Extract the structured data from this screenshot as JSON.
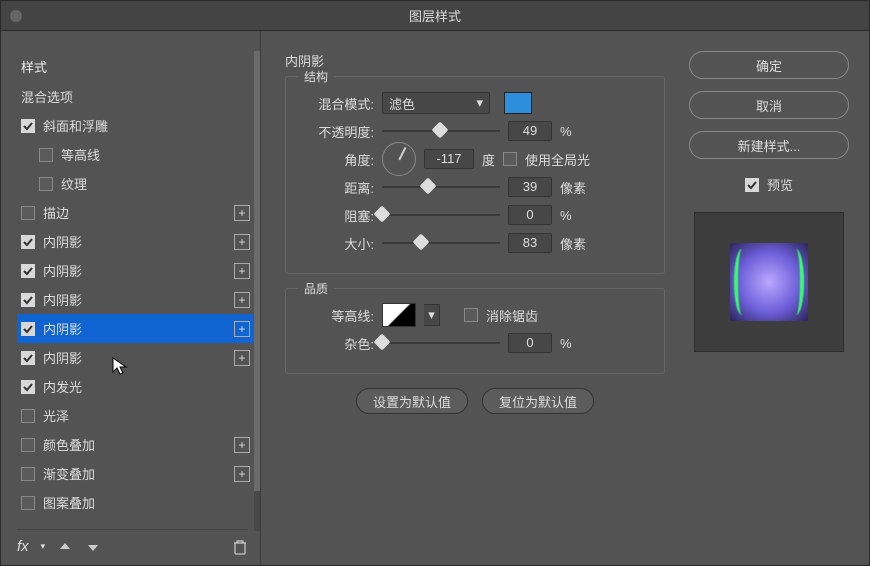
{
  "dialog_title": "图层样式",
  "sidebar": {
    "header": "样式",
    "items": [
      {
        "label": "混合选项",
        "checked": null,
        "add": false,
        "indent": 0
      },
      {
        "label": "斜面和浮雕",
        "checked": true,
        "add": false,
        "indent": 0
      },
      {
        "label": "等高线",
        "checked": false,
        "add": false,
        "indent": 1
      },
      {
        "label": "纹理",
        "checked": false,
        "add": false,
        "indent": 1
      },
      {
        "label": "描边",
        "checked": false,
        "add": true,
        "indent": 0
      },
      {
        "label": "内阴影",
        "checked": true,
        "add": true,
        "indent": 0
      },
      {
        "label": "内阴影",
        "checked": true,
        "add": true,
        "indent": 0
      },
      {
        "label": "内阴影",
        "checked": true,
        "add": true,
        "indent": 0
      },
      {
        "label": "内阴影",
        "checked": true,
        "add": true,
        "indent": 0,
        "selected": true
      },
      {
        "label": "内阴影",
        "checked": true,
        "add": true,
        "indent": 0
      },
      {
        "label": "内发光",
        "checked": true,
        "add": false,
        "indent": 0
      },
      {
        "label": "光泽",
        "checked": false,
        "add": false,
        "indent": 0
      },
      {
        "label": "颜色叠加",
        "checked": false,
        "add": true,
        "indent": 0
      },
      {
        "label": "渐变叠加",
        "checked": false,
        "add": true,
        "indent": 0
      },
      {
        "label": "图案叠加",
        "checked": false,
        "add": false,
        "indent": 0
      }
    ],
    "fx_label": "fx"
  },
  "panel": {
    "title": "内阴影",
    "group_structure": "结构",
    "group_quality": "品质",
    "blend_mode_label": "混合模式:",
    "blend_mode_value": "滤色",
    "swatch_color": "#2d8fdb",
    "opacity_label": "不透明度:",
    "opacity_value": "49",
    "percent": "%",
    "angle_label": "角度:",
    "angle_value": "-117",
    "angle_unit": "度",
    "global_light_label": "使用全局光",
    "global_light_checked": false,
    "distance_label": "距离:",
    "distance_value": "39",
    "px": "像素",
    "choke_label": "阻塞:",
    "choke_value": "0",
    "size_label": "大小:",
    "size_value": "83",
    "contour_label": "等高线:",
    "antialias_label": "消除锯齿",
    "antialias_checked": false,
    "noise_label": "杂色:",
    "noise_value": "0",
    "btn_default": "设置为默认值",
    "btn_reset": "复位为默认值"
  },
  "right": {
    "ok": "确定",
    "cancel": "取消",
    "new_style": "新建样式...",
    "preview_label": "预览",
    "preview_checked": true
  }
}
